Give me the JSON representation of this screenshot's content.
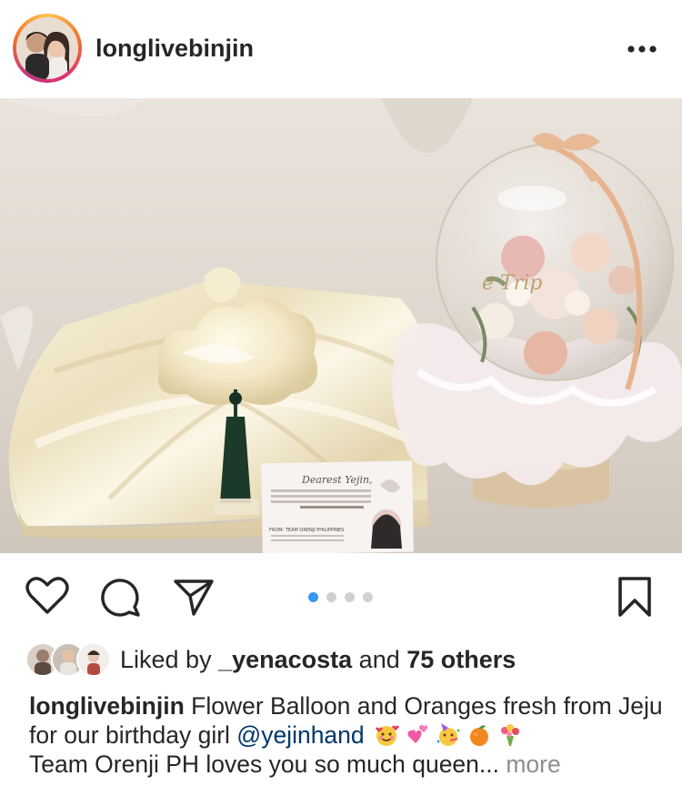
{
  "post": {
    "username": "longlivebinjin",
    "more_icon": "more-horizontal-icon"
  },
  "photo": {
    "card_title": "Dearest Yejin,",
    "card_from": "FROM: TEAM ORENJI PHILIPPINES"
  },
  "actions": {
    "like_icon": "heart-icon",
    "comment_icon": "comment-icon",
    "share_icon": "send-icon",
    "save_icon": "bookmark-icon",
    "carousel_count": 4,
    "carousel_active_index": 0,
    "active_dot_color": "#3897f0"
  },
  "likes": {
    "prefix": "Liked by ",
    "user": "_yenacosta",
    "middle": " and ",
    "others": "75 others"
  },
  "caption": {
    "user": "longlivebinjin",
    "text1": " Flower Balloon and Oranges fresh from Jeju for our birthday girl ",
    "mention": "@yejinhand",
    "emojis": [
      "smiling-face-with-hearts",
      "two-hearts",
      "partying-face",
      "tangerine",
      "bouquet"
    ],
    "text2": "Team Orenji PH loves you so much queen...",
    "more": " more"
  }
}
